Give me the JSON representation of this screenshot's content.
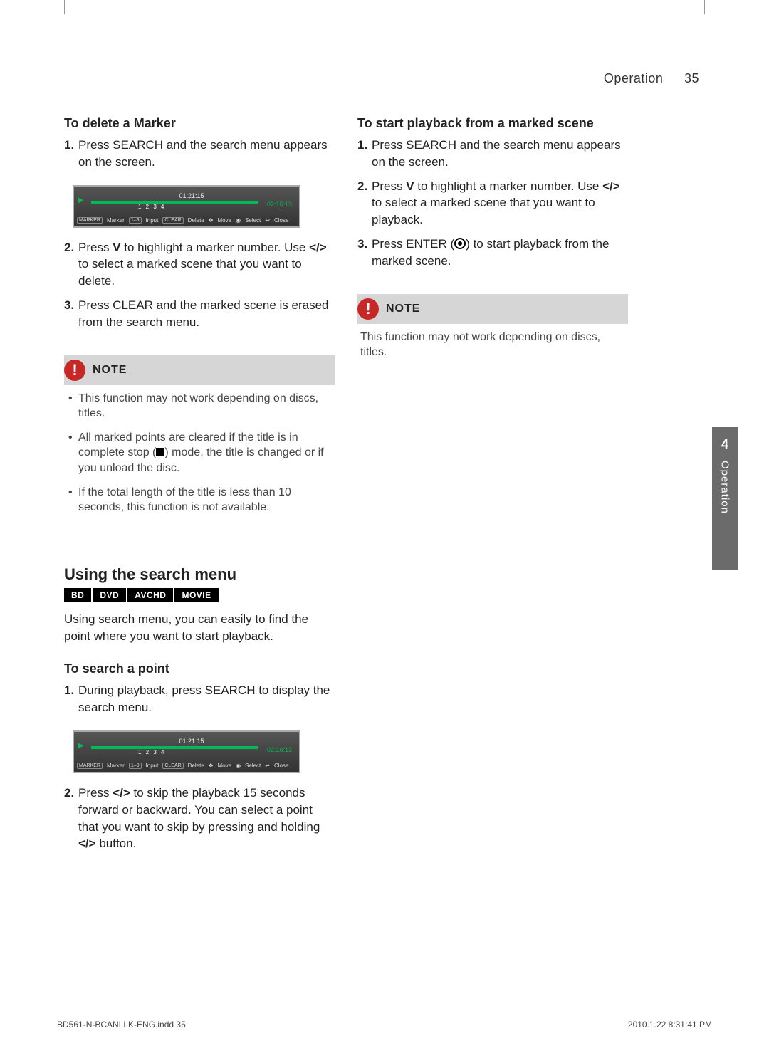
{
  "header": {
    "section": "Operation",
    "page": "35"
  },
  "sidetab": {
    "num": "4",
    "label": "Operation"
  },
  "left": {
    "h1": "To delete a Marker",
    "s1_num": "1.",
    "s1": "Press SEARCH and the search menu appears on the screen.",
    "shot": {
      "cur": "01:21:15",
      "end": "02:16:13",
      "markers": "1 2 3 4",
      "c_marker": "Marker",
      "c_input": "Input",
      "c_delete": "Delete",
      "c_move": "Move",
      "c_select": "Select",
      "c_close": "Close",
      "b_marker": "MARKER",
      "b_num": "1–9",
      "b_clear": "CLEAR"
    },
    "s2_num": "2.",
    "s2a": "Press ",
    "s2b": " to highlight a marker number. Use ",
    "s2c": " to select a marked scene that you want to delete.",
    "s3_num": "3.",
    "s3": "Press CLEAR and the marked scene is erased from the search menu.",
    "note_title": "NOTE",
    "note1": "This function may not work depending on discs, titles.",
    "note2a": "All marked points are cleared if the title is in complete stop (",
    "note2b": ") mode, the title is changed or if you unload the disc.",
    "note3": "If the total length of the title is less than 10 seconds, this function is not available.",
    "sec_title": "Using the search menu",
    "badges": {
      "bd": "BD",
      "dvd": "DVD",
      "avchd": "AVCHD",
      "movie": "MOVIE"
    },
    "sec_body": "Using search menu, you can easily to find the point where you want to start playback.",
    "h2": "To search a point",
    "p1_num": "1.",
    "p1": "During playback, press SEARCH to display the search menu.",
    "p2_num": "2.",
    "p2a": "Press ",
    "p2b": " to skip the playback 15 seconds forward or backward. You can select a point that you want to skip by pressing and holding ",
    "p2c": " button."
  },
  "right": {
    "h1": "To start playback from a marked scene",
    "s1_num": "1.",
    "s1": "Press SEARCH and the search menu appears on the screen.",
    "s2_num": "2.",
    "s2a": "Press ",
    "s2b": " to highlight a marker number. Use ",
    "s2c": " to select a marked scene that you want to playback.",
    "s3_num": "3.",
    "s3a": "Press ENTER (",
    "s3b": ") to start playback from the marked scene.",
    "note_title": "NOTE",
    "note1": "This function may not work depending on discs, titles."
  },
  "footer": {
    "file": "BD561-N-BCANLLK-ENG.indd   35",
    "stamp": "2010.1.22   8:31:41 PM"
  }
}
